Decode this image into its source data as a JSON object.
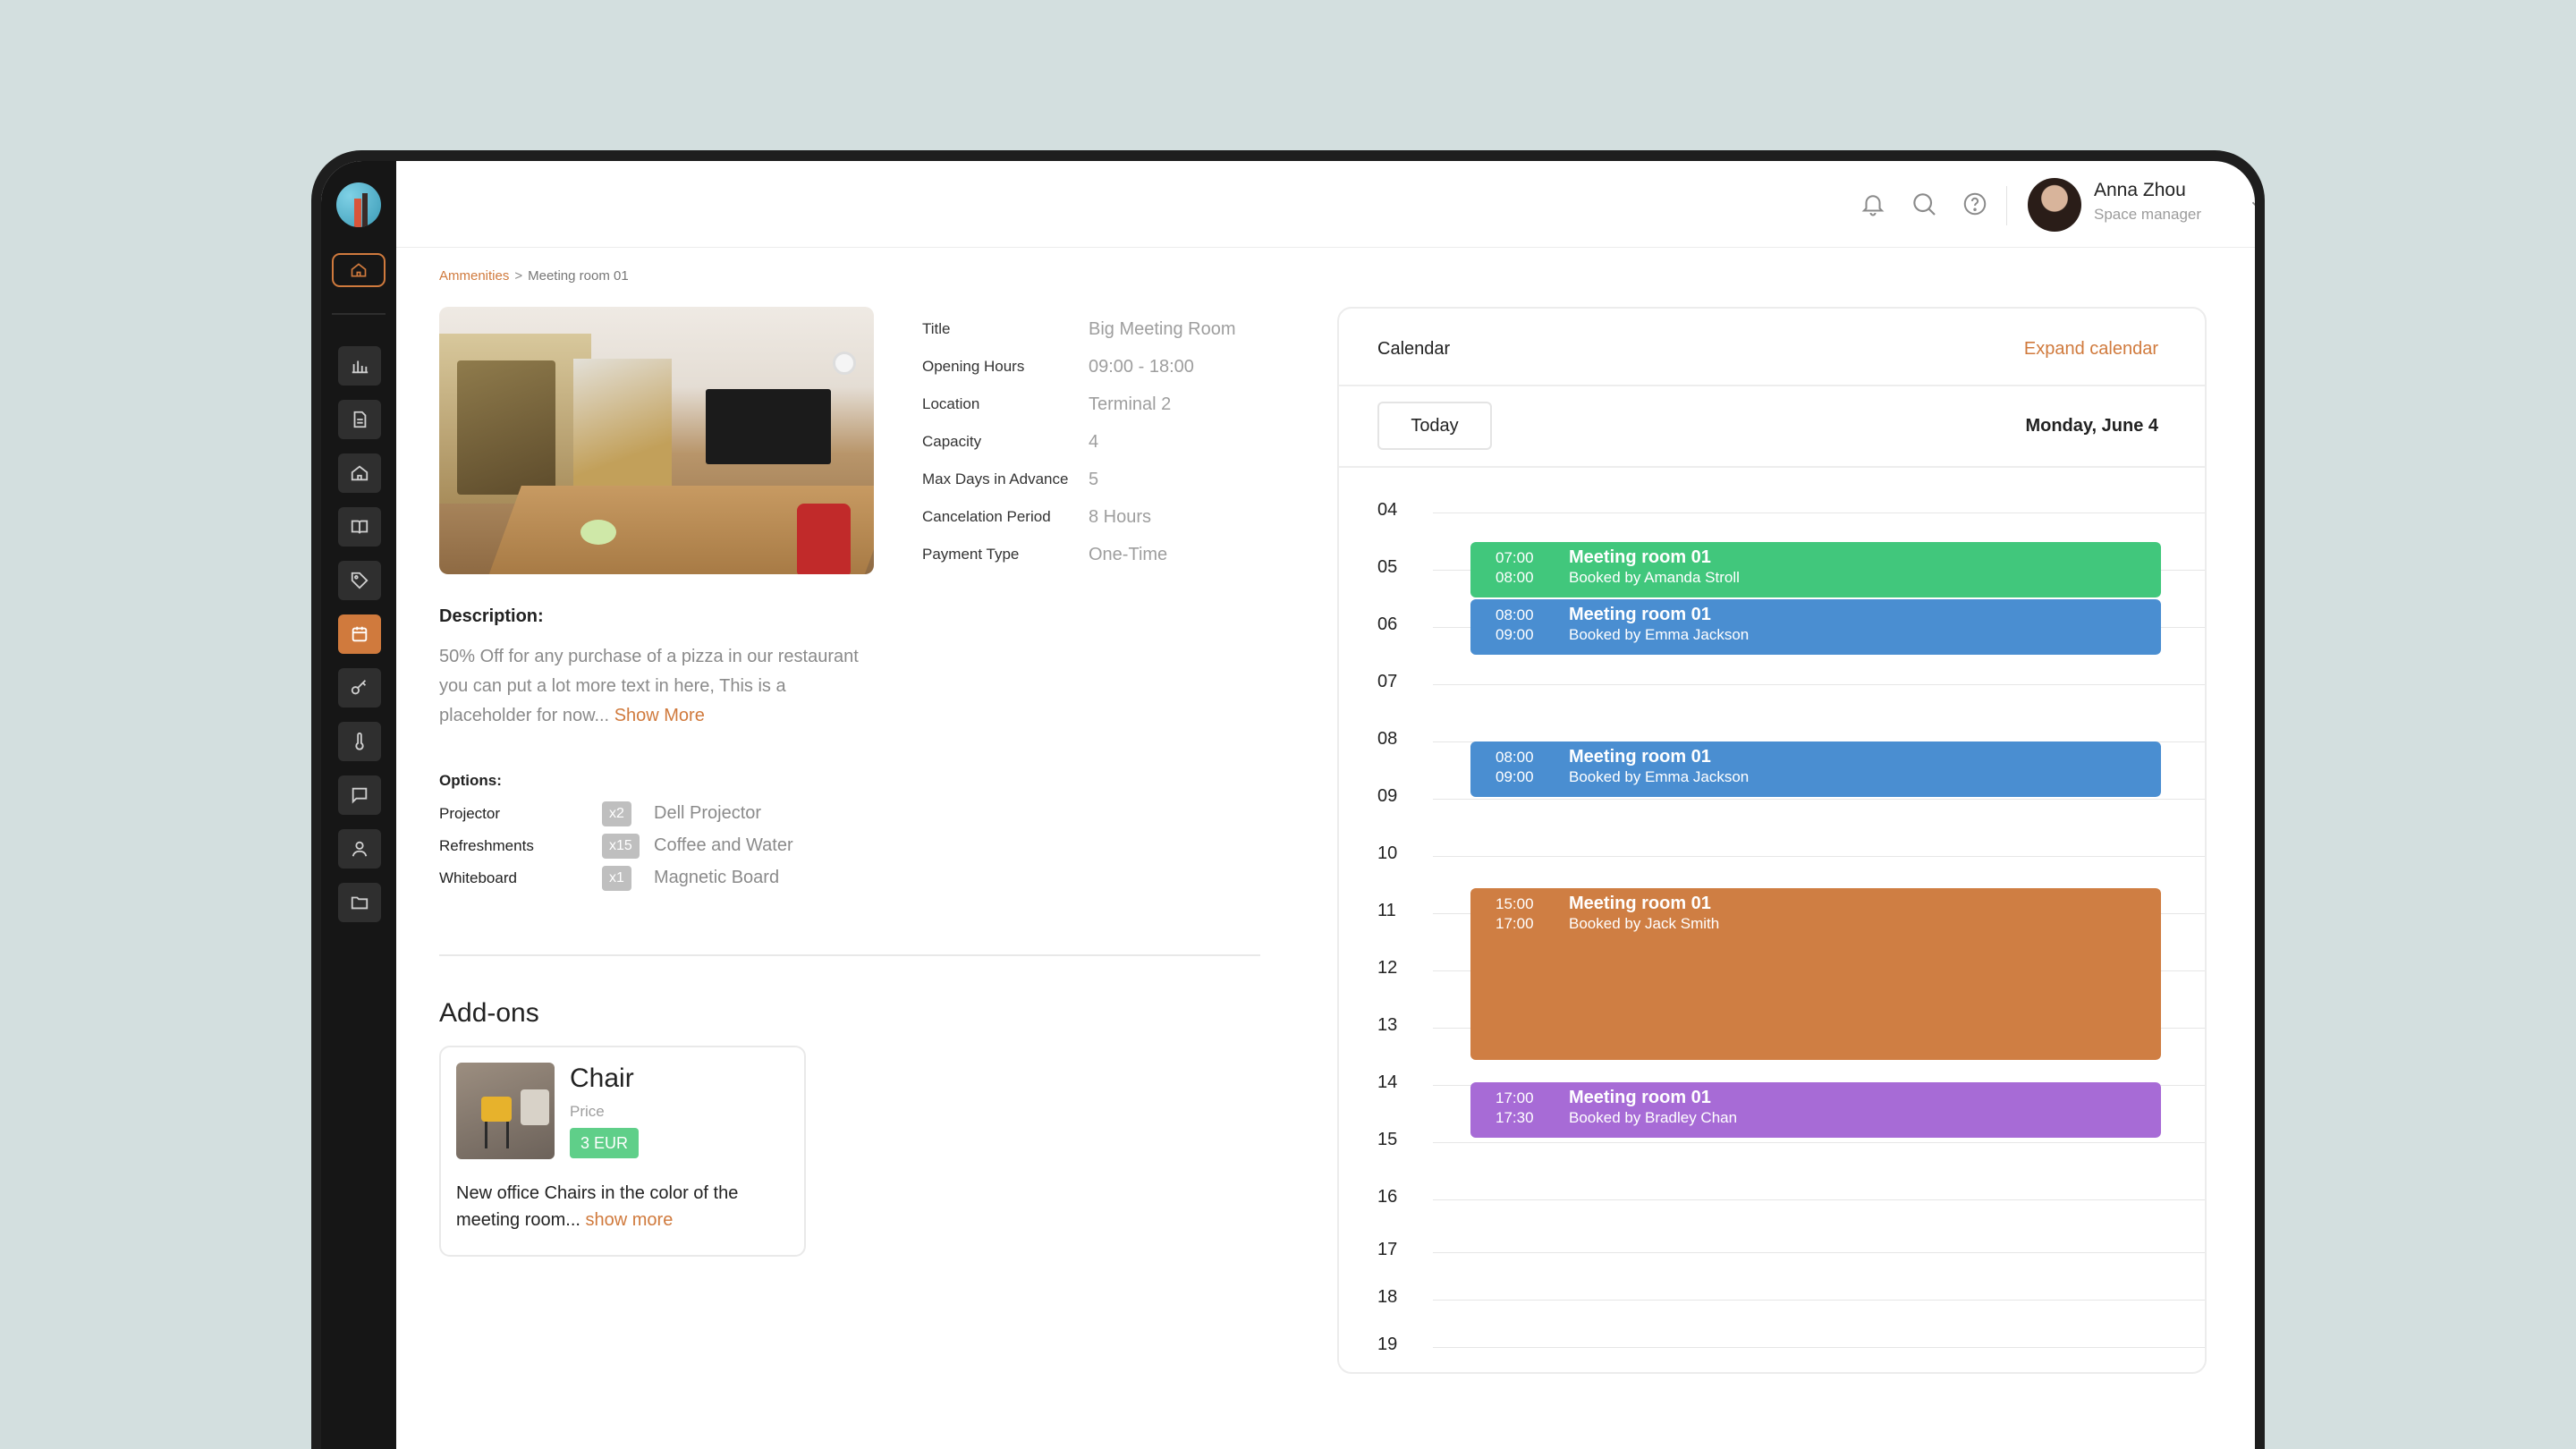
{
  "user": {
    "name": "Anna Zhou",
    "role": "Space manager"
  },
  "breadcrumb": {
    "parent": "Ammenities",
    "separator": ">",
    "current": "Meeting room 01"
  },
  "details": [
    {
      "label": "Title",
      "value": "Big Meeting Room"
    },
    {
      "label": "Opening Hours",
      "value": "09:00 - 18:00"
    },
    {
      "label": "Location",
      "value": "Terminal 2"
    },
    {
      "label": "Capacity",
      "value": "4"
    },
    {
      "label": "Max Days in Advance",
      "value": "5"
    },
    {
      "label": "Cancelation Period",
      "value": "8 Hours"
    },
    {
      "label": "Payment Type",
      "value": "One-Time"
    }
  ],
  "description": {
    "title": "Description:",
    "text": "50% Off for any purchase of a pizza in our restaurant you can put a lot more text in here, This is a placeholder for now...",
    "more": "Show More"
  },
  "options": {
    "title": "Options:",
    "items": [
      {
        "name": "Projector",
        "qty": "x2",
        "desc": "Dell Projector"
      },
      {
        "name": "Refreshments",
        "qty": "x15",
        "desc": "Coffee and Water"
      },
      {
        "name": "Whiteboard",
        "qty": "x1",
        "desc": "Magnetic Board"
      }
    ]
  },
  "addons": {
    "title": "Add-ons",
    "card": {
      "name": "Chair",
      "price_label": "Price",
      "price": "3 EUR",
      "desc": "New office Chairs in the color of the meeting room...",
      "more": "show more"
    }
  },
  "calendar": {
    "title": "Calendar",
    "expand": "Expand calendar",
    "today": "Today",
    "date": "Monday, June 4",
    "hours": [
      "04",
      "05",
      "06",
      "07",
      "08",
      "09",
      "10",
      "11",
      "12",
      "13",
      "14",
      "15",
      "16",
      "17",
      "18",
      "19"
    ],
    "events": [
      {
        "start": "07:00",
        "end": "08:00",
        "title": "Meeting room 01",
        "by": "Booked by Amanda Stroll",
        "color": "#41c77c"
      },
      {
        "start": "08:00",
        "end": "09:00",
        "title": "Meeting room 01",
        "by": "Booked by Emma Jackson",
        "color": "#4a8ed1"
      },
      {
        "start": "08:00",
        "end": "09:00",
        "title": "Meeting room 01",
        "by": "Booked by Emma Jackson",
        "color": "#4a8ed1"
      },
      {
        "start": "15:00",
        "end": "17:00",
        "title": "Meeting room 01",
        "by": "Booked by Jack Smith",
        "color": "#cf7e43"
      },
      {
        "start": "17:00",
        "end": "17:30",
        "title": "Meeting room 01",
        "by": "Booked by Bradley Chan",
        "color": "#a76bd6"
      }
    ]
  },
  "nav_icons": [
    "chart-icon",
    "document-icon",
    "home-icon",
    "book-icon",
    "tag-icon",
    "calendar-icon",
    "key-icon",
    "thermometer-icon",
    "chat-icon",
    "user-icon",
    "folder-icon"
  ],
  "header_icons": [
    "bell-icon",
    "search-icon",
    "help-icon"
  ],
  "colors": {
    "accent": "#d07a3d",
    "sidebar": "#161616",
    "background": "#d3dfdf"
  }
}
